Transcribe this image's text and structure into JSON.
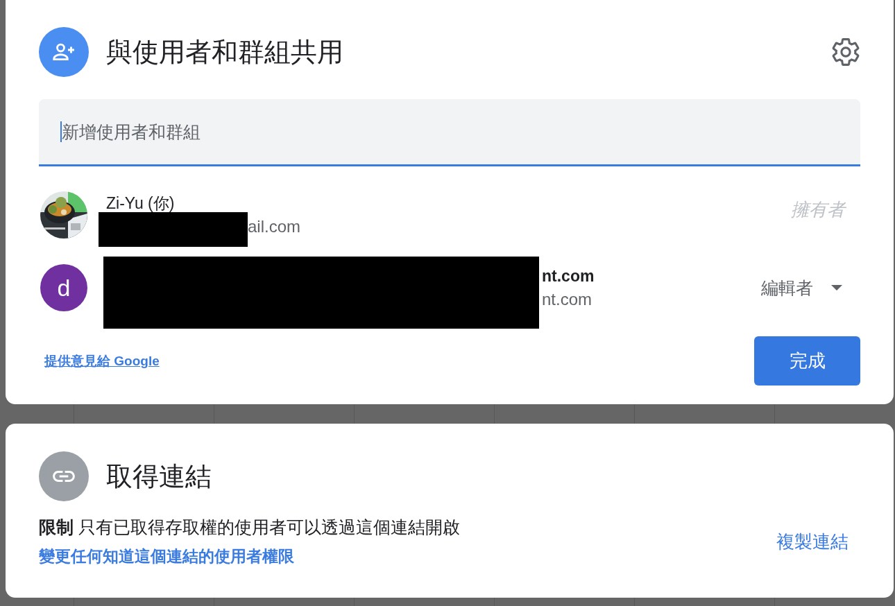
{
  "share": {
    "title": "與使用者和群組共用",
    "field": {
      "placeholder": "新增使用者和群組"
    },
    "people": [
      {
        "name": "Zi-Yu (你)",
        "email": "ail.com",
        "redacted": true,
        "role": {
          "kind": "static",
          "label": "擁有者"
        }
      },
      {
        "avatar": {
          "kind": "letter",
          "letter": "d",
          "color": "#7030a0"
        },
        "name": "nt.com",
        "email": "nt.com",
        "redacted": true,
        "role": {
          "kind": "dropdown",
          "label": "編輯者"
        }
      }
    ],
    "feedback_link": "提供意見給 Google",
    "done_button": "完成"
  },
  "link": {
    "title": "取得連結",
    "description": "**限制** 只有已取得存取權的使用者可以透過這個連結開啟",
    "change_link": "變更任何知道這個連結的使用者權限",
    "copy_button": "複製連結"
  }
}
